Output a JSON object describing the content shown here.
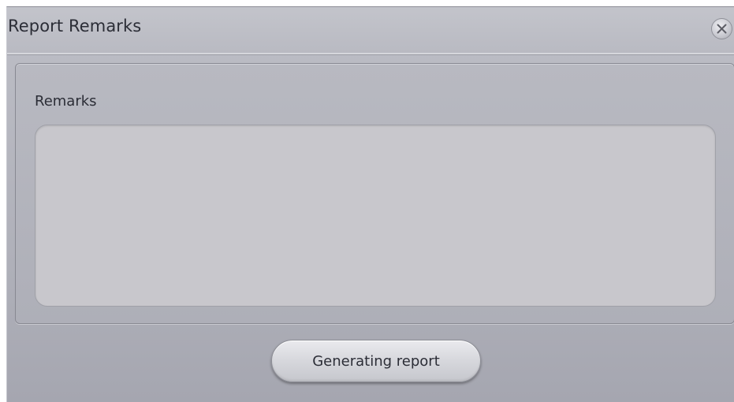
{
  "dialog": {
    "title": "Report Remarks",
    "close_icon": "close-icon"
  },
  "panel": {
    "label": "Remarks",
    "textarea_value": ""
  },
  "footer": {
    "button_label": "Generating report"
  },
  "colors": {
    "dialog_bg": "#b4b5bd",
    "textarea_bg": "#c8c7cc",
    "text": "#2b2d36"
  }
}
